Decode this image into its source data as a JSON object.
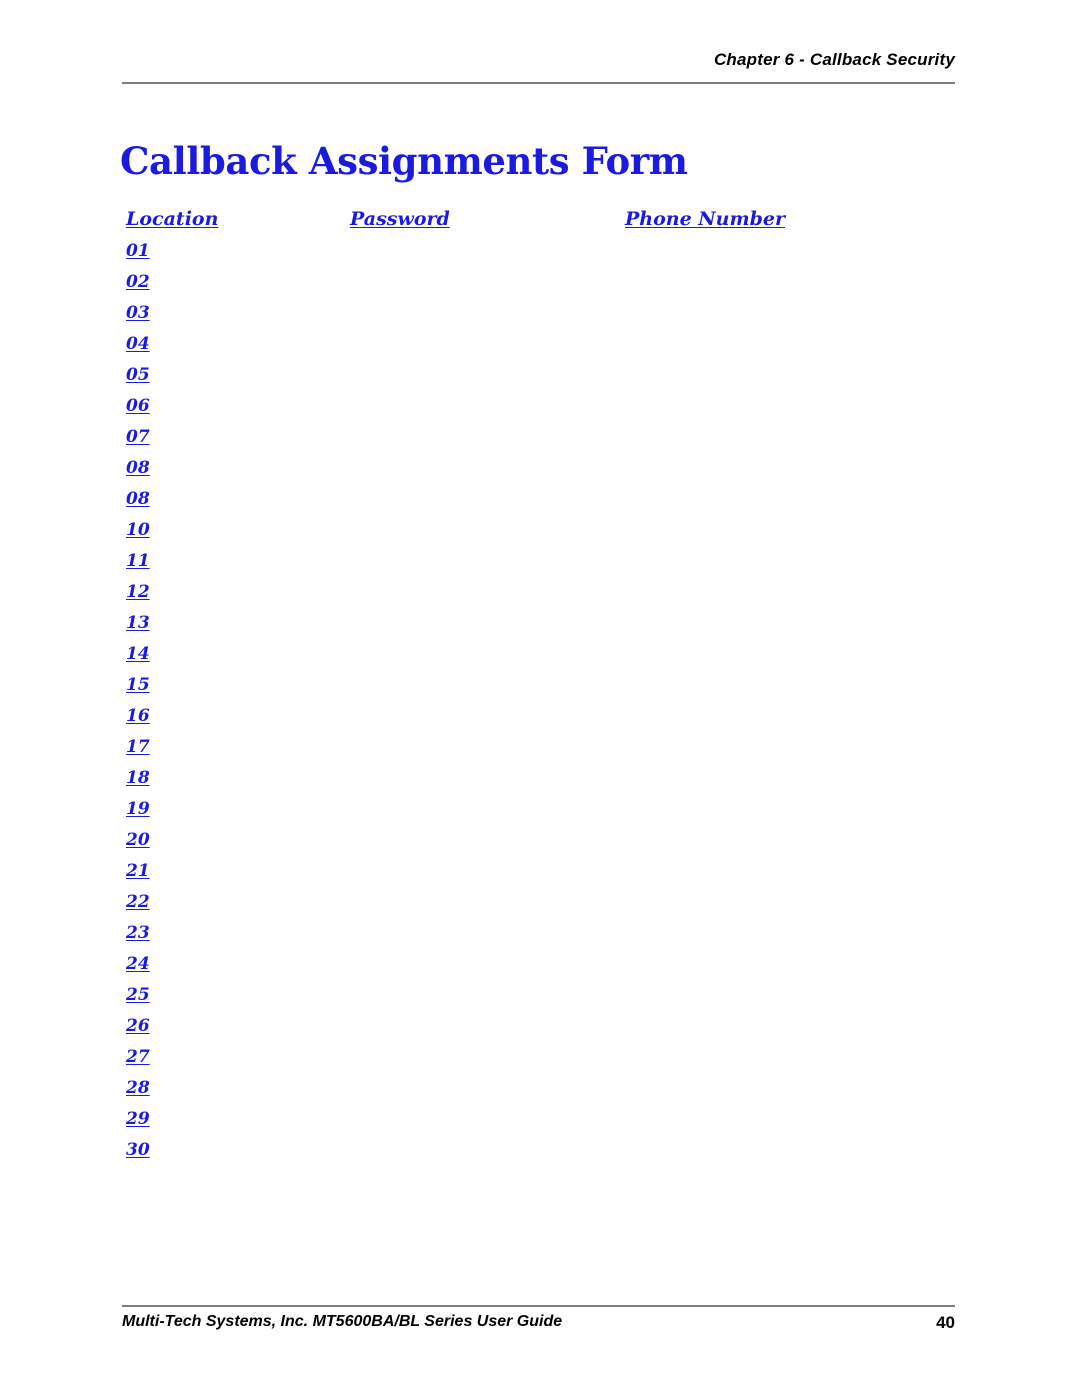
{
  "header": {
    "chapter_title": "Chapter 6 - Callback Security"
  },
  "title": "Callback Assignments Form",
  "table": {
    "columns": [
      "Location",
      "Password",
      "Phone Number"
    ],
    "rows": [
      {
        "location": "01",
        "password": "",
        "phone_number": ""
      },
      {
        "location": "02",
        "password": "",
        "phone_number": ""
      },
      {
        "location": "03",
        "password": "",
        "phone_number": ""
      },
      {
        "location": "04",
        "password": "",
        "phone_number": ""
      },
      {
        "location": "05",
        "password": "",
        "phone_number": ""
      },
      {
        "location": "06",
        "password": "",
        "phone_number": ""
      },
      {
        "location": "07",
        "password": "",
        "phone_number": ""
      },
      {
        "location": "08",
        "password": "",
        "phone_number": ""
      },
      {
        "location": "08",
        "password": "",
        "phone_number": ""
      },
      {
        "location": "10",
        "password": "",
        "phone_number": ""
      },
      {
        "location": "11",
        "password": "",
        "phone_number": ""
      },
      {
        "location": "12",
        "password": "",
        "phone_number": ""
      },
      {
        "location": "13",
        "password": "",
        "phone_number": ""
      },
      {
        "location": "14",
        "password": "",
        "phone_number": ""
      },
      {
        "location": "15",
        "password": "",
        "phone_number": ""
      },
      {
        "location": "16",
        "password": "",
        "phone_number": ""
      },
      {
        "location": "17",
        "password": "",
        "phone_number": ""
      },
      {
        "location": "18",
        "password": "",
        "phone_number": ""
      },
      {
        "location": "19",
        "password": "",
        "phone_number": ""
      },
      {
        "location": "20",
        "password": "",
        "phone_number": ""
      },
      {
        "location": "21",
        "password": "",
        "phone_number": ""
      },
      {
        "location": "22",
        "password": "",
        "phone_number": ""
      },
      {
        "location": "23",
        "password": "",
        "phone_number": ""
      },
      {
        "location": "24",
        "password": "",
        "phone_number": ""
      },
      {
        "location": "25",
        "password": "",
        "phone_number": ""
      },
      {
        "location": "26",
        "password": "",
        "phone_number": ""
      },
      {
        "location": "27",
        "password": "",
        "phone_number": ""
      },
      {
        "location": "28",
        "password": "",
        "phone_number": ""
      },
      {
        "location": "29",
        "password": "",
        "phone_number": ""
      },
      {
        "location": "30",
        "password": "",
        "phone_number": ""
      }
    ]
  },
  "footer": {
    "guide_text": "Multi-Tech Systems, Inc. MT5600BA/BL Series User Guide",
    "page_number": "40"
  },
  "colors": {
    "accent_blue": "#1b1be0",
    "rule_gray": "#7d7d7d",
    "text_black": "#000000",
    "page_background": "#ffffff"
  }
}
